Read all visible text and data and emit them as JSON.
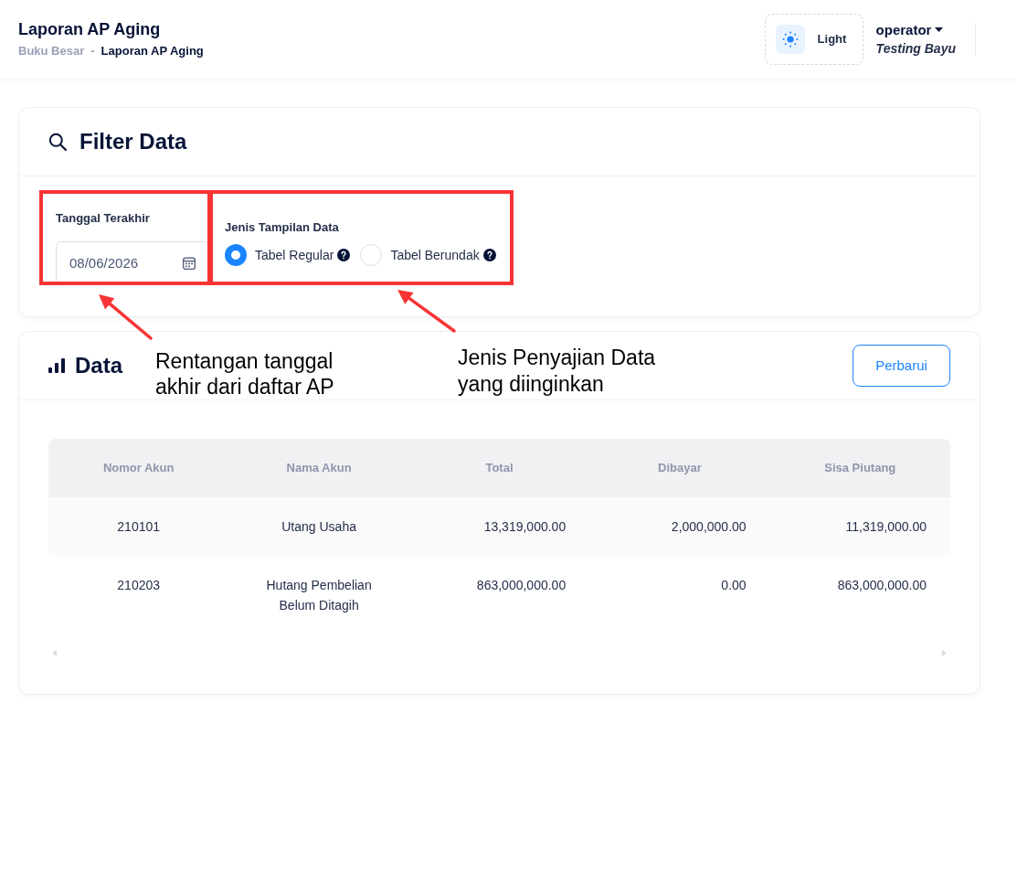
{
  "header": {
    "title": "Laporan AP Aging",
    "breadcrumb": {
      "separator": "-",
      "items": [
        {
          "label": "Buku Besar",
          "current": false
        },
        {
          "label": "Laporan AP Aging",
          "current": true
        }
      ]
    },
    "theme_toggle": {
      "label": "Light"
    },
    "user": {
      "name": "operator",
      "subtitle": "Testing Bayu"
    }
  },
  "filter_card": {
    "title": "Filter Data",
    "date_field": {
      "label": "Tanggal Terakhir",
      "value": "08/06/2026"
    },
    "display_type": {
      "label": "Jenis Tampilan Data",
      "options": [
        {
          "label": "Tabel Regular",
          "selected": true
        },
        {
          "label": "Tabel Berundak",
          "selected": false
        }
      ]
    }
  },
  "data_card": {
    "title": "Data",
    "button": "Perbarui",
    "table": {
      "columns": [
        {
          "label": "Nomor Akun",
          "kind": "text"
        },
        {
          "label": "Nama Akun",
          "kind": "text"
        },
        {
          "label": "Total",
          "kind": "number"
        },
        {
          "label": "Dibayar",
          "kind": "number"
        },
        {
          "label": "Sisa Piutang",
          "kind": "number"
        }
      ],
      "rows": [
        {
          "cells": [
            "210101",
            "Utang Usaha",
            "13,319,000.00",
            "2,000,000.00",
            "11,319,000.00"
          ]
        },
        {
          "cells": [
            "210203",
            "Hutang Pembelian Belum Ditagih",
            "863,000,000.00",
            "0.00",
            "863,000,000.00"
          ]
        }
      ]
    }
  },
  "annotations": [
    {
      "lines": [
        "Rentangan tanggal",
        "akhir dari daftar AP"
      ]
    },
    {
      "lines": [
        "Jenis Penyajian Data",
        "yang diinginkan"
      ]
    }
  ]
}
